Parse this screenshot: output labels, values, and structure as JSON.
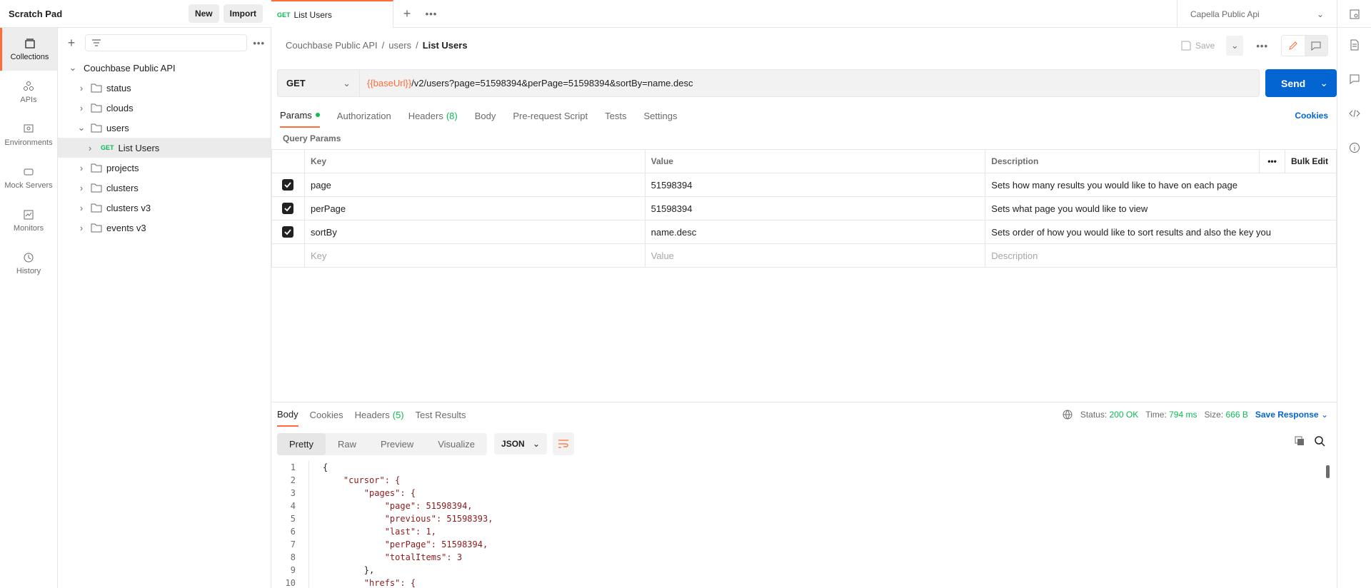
{
  "app": {
    "workspace_title": "Scratch Pad",
    "new_label": "New",
    "import_label": "Import"
  },
  "rail": [
    {
      "label": "Collections",
      "icon": "collections-icon"
    },
    {
      "label": "APIs",
      "icon": "apis-icon"
    },
    {
      "label": "Environments",
      "icon": "environments-icon"
    },
    {
      "label": "Mock Servers",
      "icon": "mock-servers-icon"
    },
    {
      "label": "Monitors",
      "icon": "monitors-icon"
    },
    {
      "label": "History",
      "icon": "history-icon"
    }
  ],
  "sidebar": {
    "collection": "Couchbase Public API",
    "folders": [
      {
        "label": "status"
      },
      {
        "label": "clouds"
      },
      {
        "label": "users"
      },
      {
        "label": "projects"
      },
      {
        "label": "clusters"
      },
      {
        "label": "clusters v3"
      },
      {
        "label": "events v3"
      }
    ],
    "request": {
      "method": "GET",
      "label": "List Users"
    }
  },
  "tabs": {
    "active": {
      "method": "GET",
      "label": "List Users"
    },
    "environment": "Capella Public Api"
  },
  "breadcrumb": {
    "collection": "Couchbase Public API",
    "folder": "users",
    "current": "List Users",
    "save_label": "Save"
  },
  "request": {
    "method": "GET",
    "url_var": "{{baseUrl}}",
    "url_rest": "/v2/users?page=51598394&perPage=51598394&sortBy=name.desc",
    "send_label": "Send",
    "tabs": {
      "params": "Params",
      "authorization": "Authorization",
      "headers": "Headers",
      "headers_count": "(8)",
      "body": "Body",
      "prerequest": "Pre-request Script",
      "tests": "Tests",
      "settings": "Settings"
    },
    "cookies_label": "Cookies"
  },
  "params": {
    "section_label": "Query Params",
    "headers": {
      "key": "Key",
      "value": "Value",
      "description": "Description",
      "bulk_edit": "Bulk Edit"
    },
    "rows": [
      {
        "key": "page",
        "value": "51598394",
        "description": "Sets how many results you would like to have on each page"
      },
      {
        "key": "perPage",
        "value": "51598394",
        "description": "Sets what page you would like to view"
      },
      {
        "key": "sortBy",
        "value": "name.desc",
        "description": "Sets order of how you would like to sort results and also the key you"
      }
    ],
    "placeholders": {
      "key": "Key",
      "value": "Value",
      "description": "Description"
    }
  },
  "response": {
    "tabs": {
      "body": "Body",
      "cookies": "Cookies",
      "headers": "Headers",
      "headers_count": "(5)",
      "tests": "Test Results"
    },
    "status_label": "Status:",
    "status_value": "200 OK",
    "time_label": "Time:",
    "time_value": "794 ms",
    "size_label": "Size:",
    "size_value": "666 B",
    "save_response": "Save Response",
    "views": {
      "pretty": "Pretty",
      "raw": "Raw",
      "preview": "Preview",
      "visualize": "Visualize"
    },
    "format": "JSON",
    "lines": [
      {
        "n": "1",
        "text": "{"
      },
      {
        "n": "2",
        "text": "    \"cursor\": {"
      },
      {
        "n": "3",
        "text": "        \"pages\": {"
      },
      {
        "n": "4",
        "text": "            \"page\": 51598394,"
      },
      {
        "n": "5",
        "text": "            \"previous\": 51598393,"
      },
      {
        "n": "6",
        "text": "            \"last\": 1,"
      },
      {
        "n": "7",
        "text": "            \"perPage\": 51598394,"
      },
      {
        "n": "8",
        "text": "            \"totalItems\": 3"
      },
      {
        "n": "9",
        "text": "        },"
      },
      {
        "n": "10",
        "text": "        \"hrefs\": {"
      }
    ]
  },
  "colors": {
    "accent": "#ff6c37",
    "primary": "#0265d2",
    "success": "#0cbb52"
  }
}
